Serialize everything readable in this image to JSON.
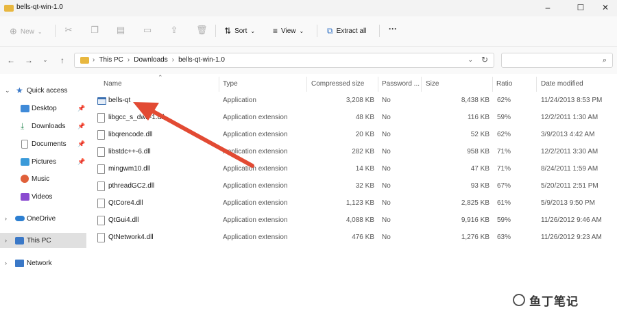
{
  "window": {
    "title": "bells-qt-win-1.0"
  },
  "window_controls": {
    "minimize": "–",
    "maximize": "☐",
    "close": "✕"
  },
  "toolbar": {
    "new_label": "New",
    "sort_label": "Sort",
    "view_label": "View",
    "extract_label": "Extract all",
    "more_label": "···"
  },
  "address": {
    "crumbs": [
      "This PC",
      "Downloads",
      "bells-qt-win-1.0"
    ]
  },
  "sidebar": {
    "items": [
      {
        "label": "Quick access",
        "icon": "star-icon",
        "color": "#3a78c7"
      },
      {
        "label": "Desktop",
        "icon": "desktop-icon",
        "color": "#3f8ad8"
      },
      {
        "label": "Downloads",
        "icon": "download-icon",
        "color": "#2e8b57"
      },
      {
        "label": "Documents",
        "icon": "document-icon",
        "color": "#8a8a8a"
      },
      {
        "label": "Pictures",
        "icon": "picture-icon",
        "color": "#3a9ad9"
      },
      {
        "label": "Music",
        "icon": "music-icon",
        "color": "#e0603a"
      },
      {
        "label": "Videos",
        "icon": "video-icon",
        "color": "#8a4ad0"
      },
      {
        "label": "OneDrive",
        "icon": "cloud-icon",
        "color": "#2d7fd1"
      },
      {
        "label": "This PC",
        "icon": "computer-icon",
        "color": "#3a78c7"
      },
      {
        "label": "Network",
        "icon": "network-icon",
        "color": "#3a78c7"
      }
    ]
  },
  "columns": {
    "name": "Name",
    "type": "Type",
    "compressed_size": "Compressed size",
    "password": "Password ...",
    "size": "Size",
    "ratio": "Ratio",
    "date_modified": "Date modified"
  },
  "files": [
    {
      "name": "bells-qt",
      "type": "Application",
      "compressed": "3,208 KB",
      "password": "No",
      "size": "8,438 KB",
      "ratio": "62%",
      "date": "11/24/2013 8:53 PM"
    },
    {
      "name": "libgcc_s_dw2-1.dll",
      "type": "Application extension",
      "compressed": "48 KB",
      "password": "No",
      "size": "116 KB",
      "ratio": "59%",
      "date": "12/2/2011 1:30 AM"
    },
    {
      "name": "libqrencode.dll",
      "type": "Application extension",
      "compressed": "20 KB",
      "password": "No",
      "size": "52 KB",
      "ratio": "62%",
      "date": "3/9/2013 4:42 AM"
    },
    {
      "name": "libstdc++-6.dll",
      "type": "Application extension",
      "compressed": "282 KB",
      "password": "No",
      "size": "958 KB",
      "ratio": "71%",
      "date": "12/2/2011 3:30 AM"
    },
    {
      "name": "mingwm10.dll",
      "type": "Application extension",
      "compressed": "14 KB",
      "password": "No",
      "size": "47 KB",
      "ratio": "71%",
      "date": "8/24/2011 1:59 AM"
    },
    {
      "name": "pthreadGC2.dll",
      "type": "Application extension",
      "compressed": "32 KB",
      "password": "No",
      "size": "93 KB",
      "ratio": "67%",
      "date": "5/20/2011 2:51 PM"
    },
    {
      "name": "QtCore4.dll",
      "type": "Application extension",
      "compressed": "1,123 KB",
      "password": "No",
      "size": "2,825 KB",
      "ratio": "61%",
      "date": "5/9/2013 9:50 PM"
    },
    {
      "name": "QtGui4.dll",
      "type": "Application extension",
      "compressed": "4,088 KB",
      "password": "No",
      "size": "9,916 KB",
      "ratio": "59%",
      "date": "11/26/2012 9:46 AM"
    },
    {
      "name": "QtNetwork4.dll",
      "type": "Application extension",
      "compressed": "476 KB",
      "password": "No",
      "size": "1,276 KB",
      "ratio": "63%",
      "date": "11/26/2012 9:23 AM"
    }
  ],
  "annotation": {
    "arrow_color": "#e24a33"
  },
  "watermark": {
    "text": "鱼丁笔记"
  }
}
